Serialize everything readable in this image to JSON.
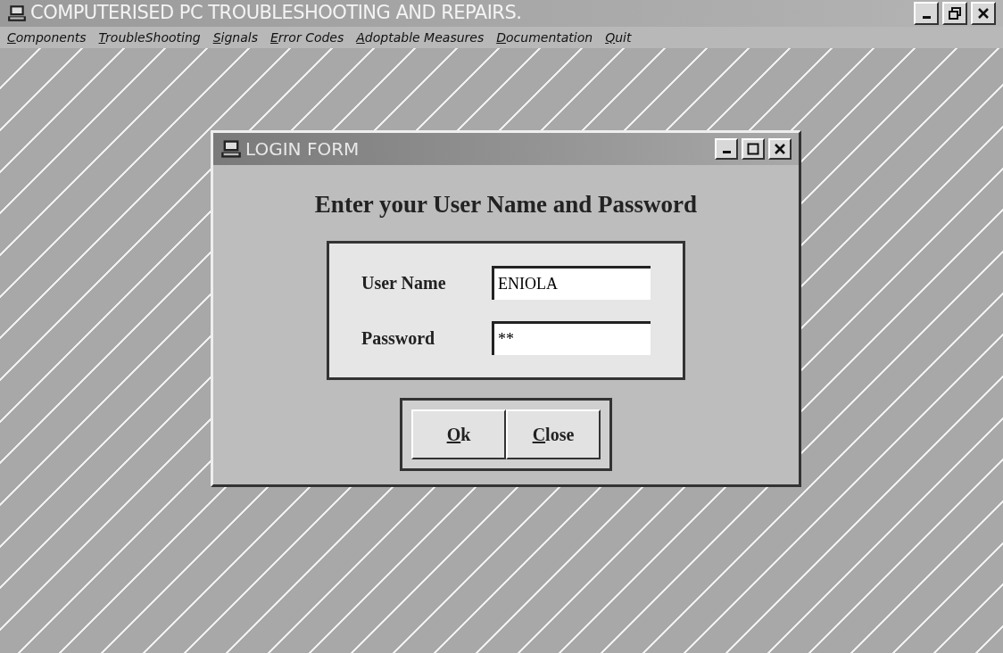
{
  "window": {
    "title": "COMPUTERISED PC TROUBLESHOOTING AND REPAIRS."
  },
  "menu": [
    {
      "label": "Components"
    },
    {
      "label": "TroubleShooting"
    },
    {
      "label": "Signals"
    },
    {
      "label": "Error Codes"
    },
    {
      "label": "Adoptable Measures"
    },
    {
      "label": "Documentation"
    },
    {
      "label": "Quit"
    }
  ],
  "dialog": {
    "title": "LOGIN FORM",
    "heading": "Enter your User Name and Password",
    "fields": [
      {
        "label": "User Name",
        "value": "ENIOLA"
      },
      {
        "label": "Password",
        "value": "**"
      }
    ],
    "buttons": [
      {
        "label": "Ok"
      },
      {
        "label": "Close"
      }
    ]
  }
}
